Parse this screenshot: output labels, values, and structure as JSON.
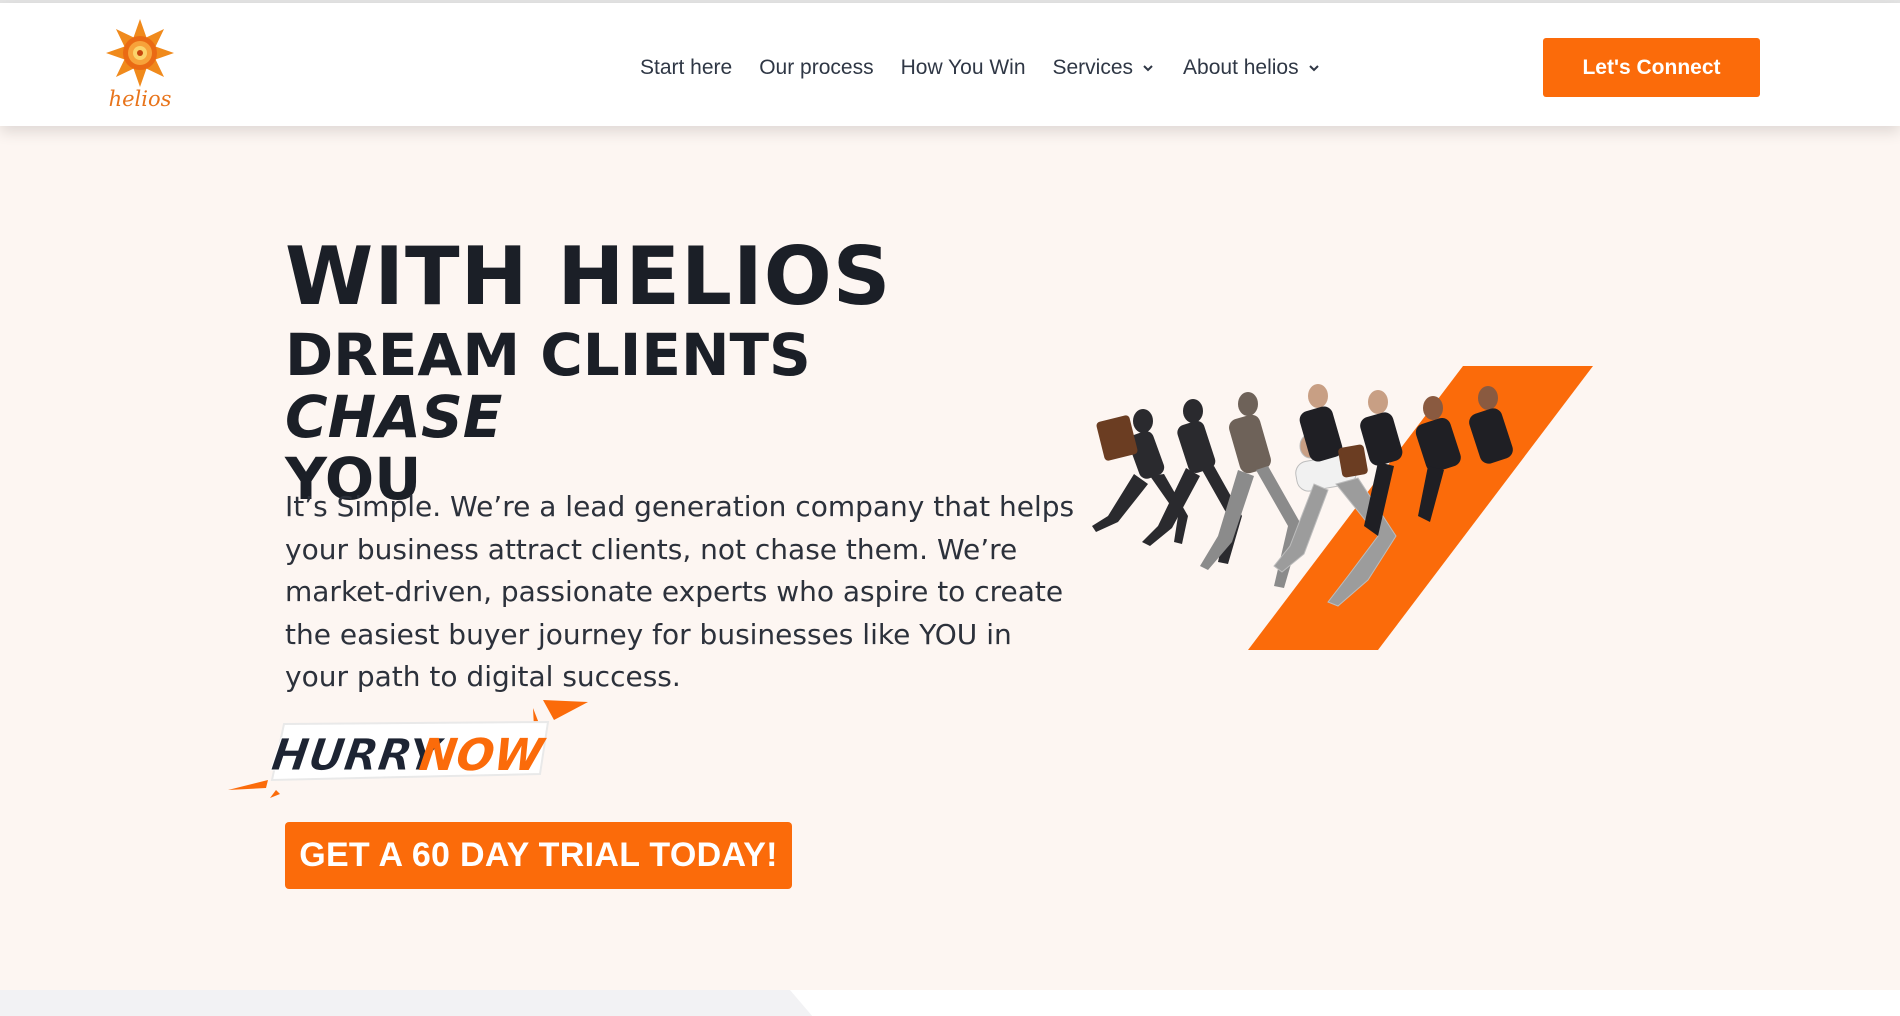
{
  "brand": {
    "name": "helios",
    "accent": "#fb6b0a",
    "logo_icon": "sun-icon"
  },
  "nav": {
    "items": [
      {
        "label": "Start here",
        "has_dropdown": false
      },
      {
        "label": "Our process",
        "has_dropdown": false
      },
      {
        "label": "How You Win",
        "has_dropdown": false
      },
      {
        "label": "Services",
        "has_dropdown": true
      },
      {
        "label": "About helios",
        "has_dropdown": true
      }
    ],
    "cta_label": "Let's Connect"
  },
  "hero": {
    "title": "WITH HELIOS",
    "subtitle_part1": "DREAM CLIENTS ",
    "subtitle_emphasis": "CHASE",
    "subtitle_part2": "YOU",
    "body": "It’s Simple. We’re a lead generation company that helps your business attract clients, not chase them. We’re market-driven, passionate experts who aspire to create the easiest buyer journey for businesses like YOU in your path to digital success.",
    "badge_word1": "HURRY",
    "badge_word2": "NOW",
    "trial_button": "GET A 60 DAY TRIAL TODAY!",
    "image": "running-businesspeople-illustration"
  },
  "colors": {
    "background": "#fdf6f2",
    "text": "#1b1f27",
    "nav_text": "#2f3745"
  }
}
